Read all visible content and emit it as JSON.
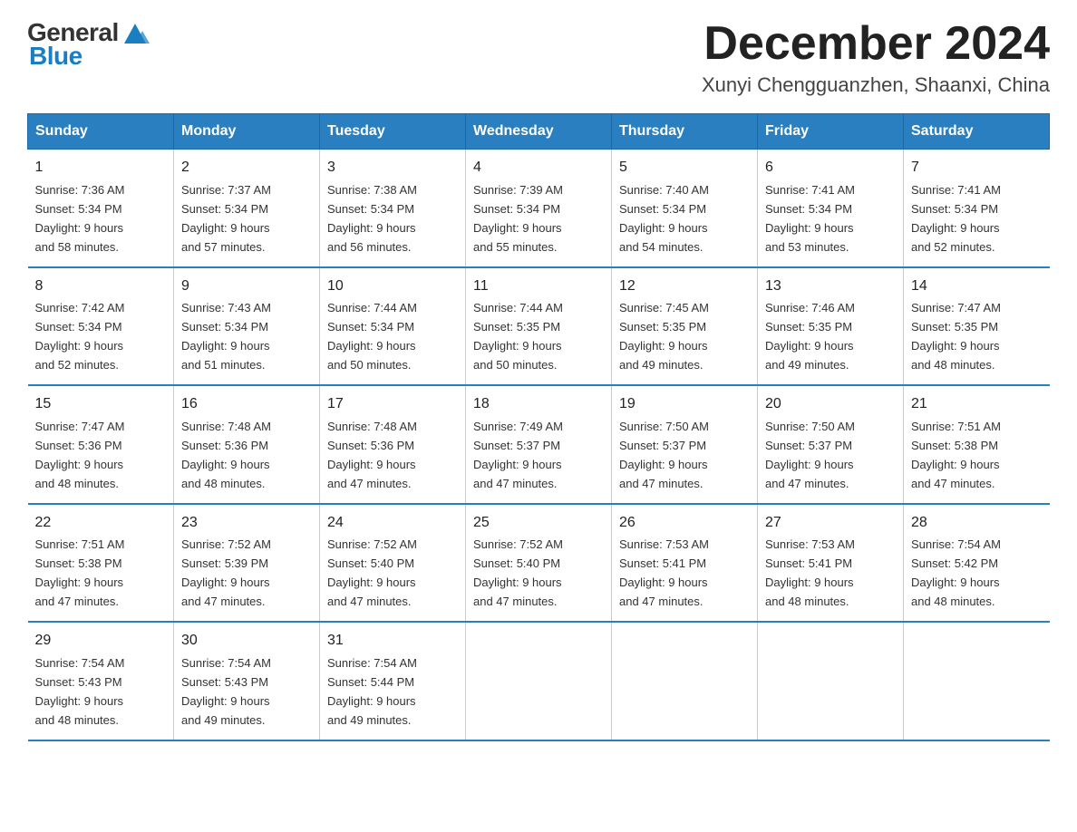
{
  "logo": {
    "text_general": "General",
    "text_blue": "Blue"
  },
  "title": "December 2024",
  "subtitle": "Xunyi Chengguanzhen, Shaanxi, China",
  "header": {
    "days": [
      "Sunday",
      "Monday",
      "Tuesday",
      "Wednesday",
      "Thursday",
      "Friday",
      "Saturday"
    ]
  },
  "weeks": [
    [
      {
        "day": "1",
        "sunrise": "7:36 AM",
        "sunset": "5:34 PM",
        "daylight": "9 hours and 58 minutes."
      },
      {
        "day": "2",
        "sunrise": "7:37 AM",
        "sunset": "5:34 PM",
        "daylight": "9 hours and 57 minutes."
      },
      {
        "day": "3",
        "sunrise": "7:38 AM",
        "sunset": "5:34 PM",
        "daylight": "9 hours and 56 minutes."
      },
      {
        "day": "4",
        "sunrise": "7:39 AM",
        "sunset": "5:34 PM",
        "daylight": "9 hours and 55 minutes."
      },
      {
        "day": "5",
        "sunrise": "7:40 AM",
        "sunset": "5:34 PM",
        "daylight": "9 hours and 54 minutes."
      },
      {
        "day": "6",
        "sunrise": "7:41 AM",
        "sunset": "5:34 PM",
        "daylight": "9 hours and 53 minutes."
      },
      {
        "day": "7",
        "sunrise": "7:41 AM",
        "sunset": "5:34 PM",
        "daylight": "9 hours and 52 minutes."
      }
    ],
    [
      {
        "day": "8",
        "sunrise": "7:42 AM",
        "sunset": "5:34 PM",
        "daylight": "9 hours and 52 minutes."
      },
      {
        "day": "9",
        "sunrise": "7:43 AM",
        "sunset": "5:34 PM",
        "daylight": "9 hours and 51 minutes."
      },
      {
        "day": "10",
        "sunrise": "7:44 AM",
        "sunset": "5:34 PM",
        "daylight": "9 hours and 50 minutes."
      },
      {
        "day": "11",
        "sunrise": "7:44 AM",
        "sunset": "5:35 PM",
        "daylight": "9 hours and 50 minutes."
      },
      {
        "day": "12",
        "sunrise": "7:45 AM",
        "sunset": "5:35 PM",
        "daylight": "9 hours and 49 minutes."
      },
      {
        "day": "13",
        "sunrise": "7:46 AM",
        "sunset": "5:35 PM",
        "daylight": "9 hours and 49 minutes."
      },
      {
        "day": "14",
        "sunrise": "7:47 AM",
        "sunset": "5:35 PM",
        "daylight": "9 hours and 48 minutes."
      }
    ],
    [
      {
        "day": "15",
        "sunrise": "7:47 AM",
        "sunset": "5:36 PM",
        "daylight": "9 hours and 48 minutes."
      },
      {
        "day": "16",
        "sunrise": "7:48 AM",
        "sunset": "5:36 PM",
        "daylight": "9 hours and 48 minutes."
      },
      {
        "day": "17",
        "sunrise": "7:48 AM",
        "sunset": "5:36 PM",
        "daylight": "9 hours and 47 minutes."
      },
      {
        "day": "18",
        "sunrise": "7:49 AM",
        "sunset": "5:37 PM",
        "daylight": "9 hours and 47 minutes."
      },
      {
        "day": "19",
        "sunrise": "7:50 AM",
        "sunset": "5:37 PM",
        "daylight": "9 hours and 47 minutes."
      },
      {
        "day": "20",
        "sunrise": "7:50 AM",
        "sunset": "5:37 PM",
        "daylight": "9 hours and 47 minutes."
      },
      {
        "day": "21",
        "sunrise": "7:51 AM",
        "sunset": "5:38 PM",
        "daylight": "9 hours and 47 minutes."
      }
    ],
    [
      {
        "day": "22",
        "sunrise": "7:51 AM",
        "sunset": "5:38 PM",
        "daylight": "9 hours and 47 minutes."
      },
      {
        "day": "23",
        "sunrise": "7:52 AM",
        "sunset": "5:39 PM",
        "daylight": "9 hours and 47 minutes."
      },
      {
        "day": "24",
        "sunrise": "7:52 AM",
        "sunset": "5:40 PM",
        "daylight": "9 hours and 47 minutes."
      },
      {
        "day": "25",
        "sunrise": "7:52 AM",
        "sunset": "5:40 PM",
        "daylight": "9 hours and 47 minutes."
      },
      {
        "day": "26",
        "sunrise": "7:53 AM",
        "sunset": "5:41 PM",
        "daylight": "9 hours and 47 minutes."
      },
      {
        "day": "27",
        "sunrise": "7:53 AM",
        "sunset": "5:41 PM",
        "daylight": "9 hours and 48 minutes."
      },
      {
        "day": "28",
        "sunrise": "7:54 AM",
        "sunset": "5:42 PM",
        "daylight": "9 hours and 48 minutes."
      }
    ],
    [
      {
        "day": "29",
        "sunrise": "7:54 AM",
        "sunset": "5:43 PM",
        "daylight": "9 hours and 48 minutes."
      },
      {
        "day": "30",
        "sunrise": "7:54 AM",
        "sunset": "5:43 PM",
        "daylight": "9 hours and 49 minutes."
      },
      {
        "day": "31",
        "sunrise": "7:54 AM",
        "sunset": "5:44 PM",
        "daylight": "9 hours and 49 minutes."
      },
      null,
      null,
      null,
      null
    ]
  ],
  "labels": {
    "sunrise": "Sunrise:",
    "sunset": "Sunset:",
    "daylight": "Daylight:"
  }
}
